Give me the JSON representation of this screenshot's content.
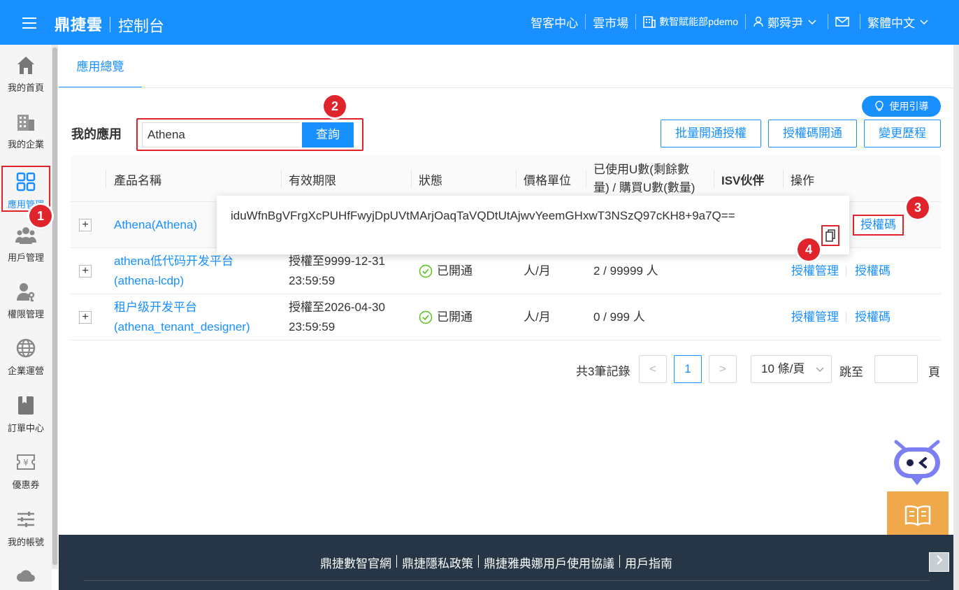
{
  "header": {
    "brand": "鼎捷雲",
    "subtitle": "控制台",
    "nav": {
      "customer_center": "智客中心",
      "cloud_market": "雲市場",
      "org": "數智賦能部pdemo",
      "user": "鄭舜尹",
      "language": "繁體中文"
    }
  },
  "sidebar": {
    "items": [
      {
        "label": "我的首頁",
        "icon": "home-icon"
      },
      {
        "label": "我的企業",
        "icon": "building-icon"
      },
      {
        "label": "應用管理",
        "icon": "grid-icon"
      },
      {
        "label": "用戶管理",
        "icon": "users-icon"
      },
      {
        "label": "權限管理",
        "icon": "user-key-icon"
      },
      {
        "label": "企業運營",
        "icon": "globe-icon"
      },
      {
        "label": "訂單中心",
        "icon": "bookmark-icon"
      },
      {
        "label": "優惠券",
        "icon": "coupon-icon"
      },
      {
        "label": "我的帳號",
        "icon": "sliders-icon"
      }
    ]
  },
  "tabs": {
    "overview": "應用總覽"
  },
  "guide_button": "使用引導",
  "my_apps_label": "我的應用",
  "search": {
    "value": "Athena",
    "button": "查詢"
  },
  "actions": {
    "batch": "批量開通授權",
    "code_open": "授權碼開通",
    "history": "變更歷程"
  },
  "table": {
    "headers": {
      "product": "產品名稱",
      "validity": "有效期限",
      "status": "狀態",
      "price_unit": "價格單位",
      "usage_line1": "已使用U數(剩餘數",
      "usage_line2": "量) / 購買U數(數量)",
      "isv": "ISV伙伴",
      "ops": "操作"
    },
    "rows": [
      {
        "name": "Athena(Athena)"
      },
      {
        "name_line1": "athena低代码开发平台",
        "name_line2": "(athena-lcdp)",
        "validity_line1": "授權至9999-12-31",
        "validity_line2": "23:59:59",
        "status": "已開通",
        "price_unit": "人/月",
        "usage": "2 / 99999 人",
        "op_manage": "授權管理",
        "op_code": "授權碼"
      },
      {
        "name_line1": "租户级开发平台",
        "name_line2": "(athena_tenant_designer)",
        "validity_line1": "授權至2026-04-30",
        "validity_line2": "23:59:59",
        "status": "已開通",
        "price_unit": "人/月",
        "usage": "0 / 999 人",
        "op_manage": "授權管理",
        "op_code": "授權碼"
      }
    ],
    "row1_op_code": "授權碼",
    "plus": "+"
  },
  "popover": {
    "code": "iduWfnBgVFrgXcPUHfFwyjDpUVtMArjOaqTaVQDtUtAjwvYeemGHxwT3NSzQ97cKH8+9a7Q=="
  },
  "badges": {
    "b1": "1",
    "b2": "2",
    "b3": "3",
    "b4": "4"
  },
  "pagination": {
    "total": "共3筆記錄",
    "prev": "<",
    "page": "1",
    "next": ">",
    "size": "10 條/頁",
    "goto": "跳至",
    "page_unit": "頁"
  },
  "footer": {
    "links": [
      "鼎捷數智官網",
      "鼎捷隱私政策",
      "鼎捷雅典娜用戶使用協議",
      "用戶指南"
    ]
  },
  "float_guide": "用戶指南",
  "colors": {
    "primary": "#1890ff",
    "header": "#1890ff",
    "highlight": "#e0242b",
    "footer": "#263646",
    "success": "#52c41a",
    "guide": "#f0a94a"
  }
}
